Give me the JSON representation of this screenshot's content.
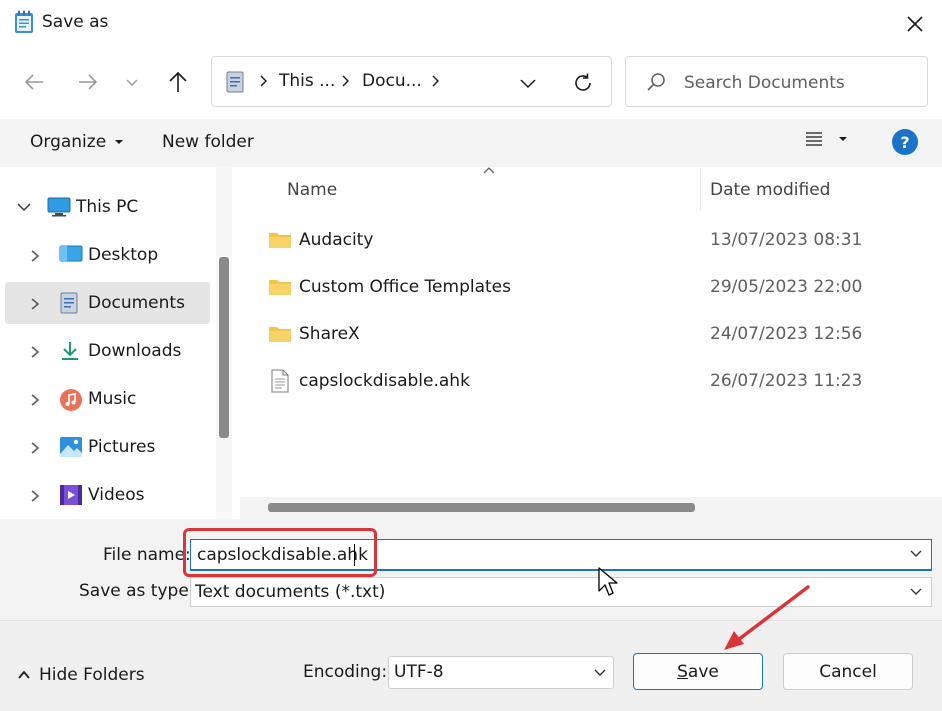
{
  "window": {
    "title": "Save as"
  },
  "address": {
    "crumbs": [
      "This ...",
      "Docu..."
    ]
  },
  "search": {
    "placeholder": "Search Documents"
  },
  "toolbar": {
    "organize": "Organize",
    "new_folder": "New folder"
  },
  "nav_pane": {
    "items": [
      {
        "label": "This PC",
        "icon": "this-pc-icon",
        "expanded": true
      },
      {
        "label": "Desktop",
        "icon": "desktop-icon"
      },
      {
        "label": "Documents",
        "icon": "documents-icon",
        "selected": true
      },
      {
        "label": "Downloads",
        "icon": "downloads-icon"
      },
      {
        "label": "Music",
        "icon": "music-icon"
      },
      {
        "label": "Pictures",
        "icon": "pictures-icon"
      },
      {
        "label": "Videos",
        "icon": "videos-icon"
      }
    ]
  },
  "file_list": {
    "columns": {
      "name": "Name",
      "date": "Date modified"
    },
    "rows": [
      {
        "name": "Audacity",
        "date": "13/07/2023 08:31",
        "type": "folder"
      },
      {
        "name": "Custom Office Templates",
        "date": "29/05/2023 22:00",
        "type": "folder"
      },
      {
        "name": "ShareX",
        "date": "24/07/2023 12:56",
        "type": "folder"
      },
      {
        "name": "capslockdisable.ahk",
        "date": "26/07/2023 11:23",
        "type": "file"
      }
    ]
  },
  "fields": {
    "file_name_label": "File name:",
    "file_name_value": "capslockdisable.ahk",
    "save_type_label": "Save as type:",
    "save_type_value": "Text documents (*.txt)"
  },
  "footer": {
    "hide_folders": "Hide Folders",
    "encoding_label": "Encoding:",
    "encoding_value": "UTF-8",
    "save_first": "S",
    "save_rest": "ave",
    "cancel": "Cancel"
  },
  "colors": {
    "accent": "#1a73c8",
    "highlight": "#d9353b",
    "folder": "#f5c542"
  }
}
